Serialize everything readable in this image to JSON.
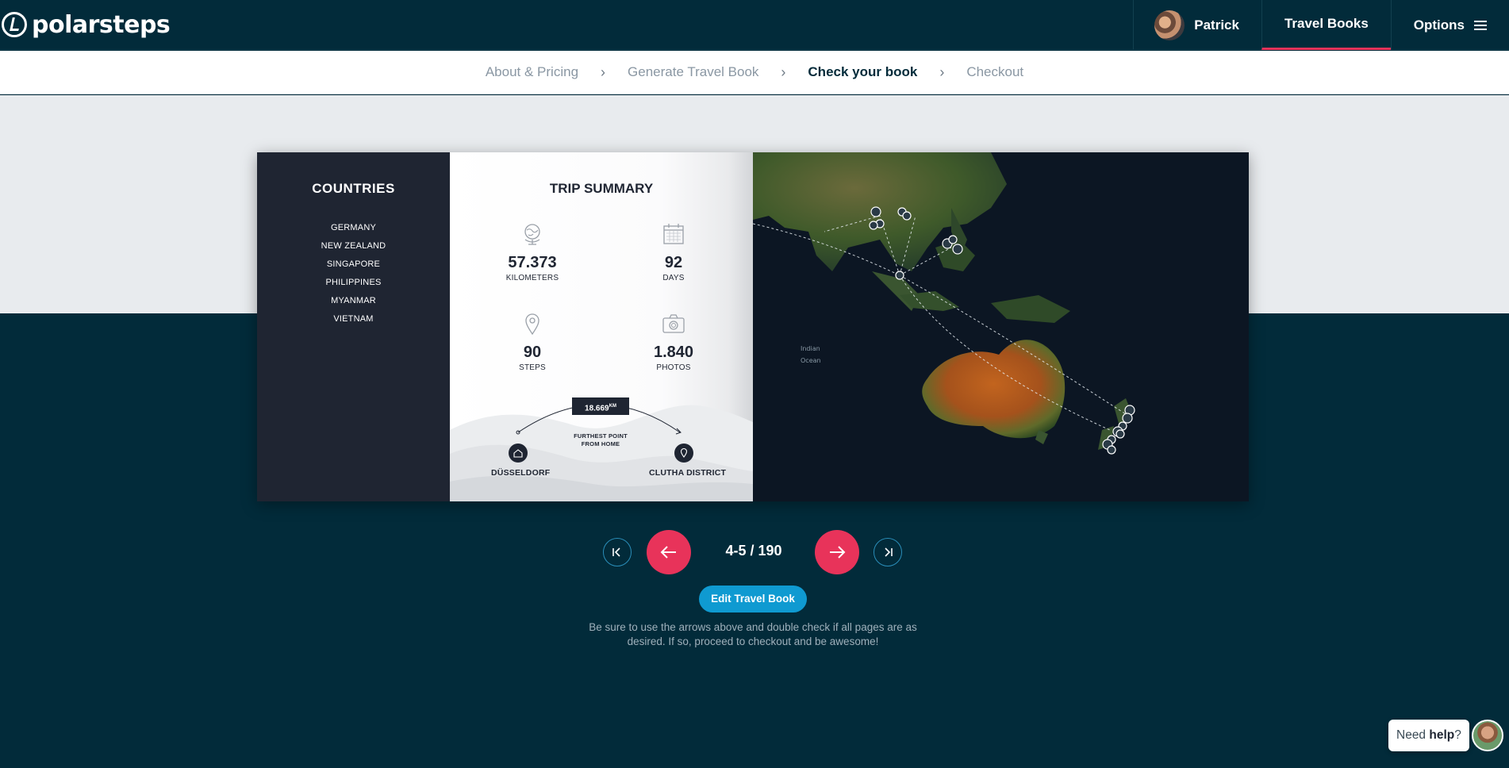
{
  "header": {
    "logo_text": "polarsteps",
    "user_name": "Patrick",
    "travel_books_label": "Travel Books",
    "options_label": "Options"
  },
  "breadcrumb": {
    "steps": [
      "About & Pricing",
      "Generate Travel Book",
      "Check your book",
      "Checkout"
    ],
    "separator": "›",
    "current_index": 2
  },
  "book": {
    "countries_title": "COUNTRIES",
    "countries": [
      "GERMANY",
      "NEW ZEALAND",
      "SINGAPORE",
      "PHILIPPINES",
      "MYANMAR",
      "VIETNAM"
    ],
    "summary_title": "TRIP SUMMARY",
    "stats": {
      "kilometers": {
        "value": "57.373",
        "label": "KILOMETERS",
        "icon": "globe-icon"
      },
      "days": {
        "value": "92",
        "label": "DAYS",
        "icon": "calendar-icon"
      },
      "steps": {
        "value": "90",
        "label": "STEPS",
        "icon": "location-pin-icon"
      },
      "photos": {
        "value": "1.840",
        "label": "PHOTOS",
        "icon": "camera-icon"
      }
    },
    "furthest": {
      "distance": "18.669",
      "distance_unit": "KM",
      "line1": "FURTHEST POINT",
      "line2": "FROM HOME",
      "home": "DÜSSELDORF",
      "destination": "CLUTHA DISTRICT"
    }
  },
  "pager": {
    "page_count": "4-5 / 190",
    "first_icon": "first-page-icon",
    "prev_icon": "arrow-left-icon",
    "next_icon": "arrow-right-icon",
    "last_icon": "last-page-icon"
  },
  "edit_button_label": "Edit Travel Book",
  "hint_text": "Be sure to use the arrows above and double check if all pages are as desired. If so, proceed to checkout and be awesome!",
  "help": {
    "prefix": "Need ",
    "strong": "help",
    "suffix": "?"
  },
  "colors": {
    "brand_dark": "#022b3a",
    "accent_red": "#e8335a",
    "accent_blue": "#0f9ad1"
  }
}
